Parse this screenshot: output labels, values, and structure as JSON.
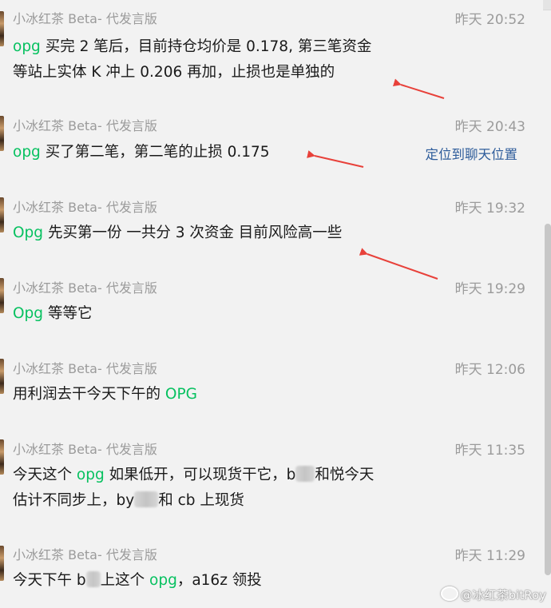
{
  "messages": [
    {
      "sender": "小冰红茶 Beta- 代发言版",
      "time": "昨天 20:52",
      "line1": {
        "kw": "opg",
        "rest": " 买完 2 笔后，目前持仓均价是 0.178, 第三笔资金"
      },
      "line2": "等站上实体 K 冲上 0.206 再加，止损也是单独的"
    },
    {
      "sender": "小冰红茶 Beta- 代发言版",
      "time": "昨天 20:43",
      "line1": {
        "kw": "opg",
        "rest": " 买了第二笔，第二笔的止损 0.175"
      },
      "action": "定位到聊天位置"
    },
    {
      "sender": "小冰红茶 Beta- 代发言版",
      "time": "昨天 19:32",
      "line1": {
        "kw": "Opg",
        "rest": " 先买第一份 一共分 3 次资金 目前风险高一些"
      }
    },
    {
      "sender": "小冰红茶 Beta- 代发言版",
      "time": "昨天 19:29",
      "line1": {
        "kw": "Opg",
        "rest": " 等等它"
      }
    },
    {
      "sender": "小冰红茶 Beta- 代发言版",
      "time": "昨天 12:06",
      "line1": {
        "pre": "用利润去干今天下午的 ",
        "kw": "OPG"
      }
    },
    {
      "sender": "小冰红茶 Beta- 代发言版",
      "time": "昨天 11:35",
      "line1": {
        "pre": "今天这个 ",
        "kw": "opg",
        "rest": " 如果低开，可以现货干它，b",
        "rest2": "和悦今天"
      },
      "line2": {
        "pre": "估计不同步上，by",
        "rest": "和 cb 上现货"
      }
    },
    {
      "sender": "小冰红茶 Beta- 代发言版",
      "time": "昨天 11:29",
      "line1": {
        "pre": "今天下午 b",
        "rest": "上这个 ",
        "kw": "opg",
        "post": "，a16z 领投"
      }
    }
  ],
  "watermark": "@冰红茶bitRoy",
  "colors": {
    "keyword": "#07c160",
    "arrow": "#e8413a",
    "link": "#2f5d9b"
  }
}
